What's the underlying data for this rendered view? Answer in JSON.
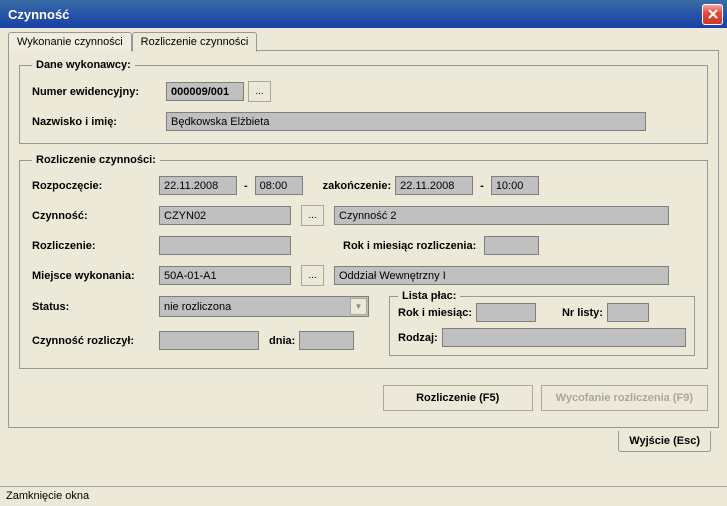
{
  "window": {
    "title": "Czynność"
  },
  "tabs": {
    "tab1": "Wykonanie czynności",
    "tab2": "Rozliczenie czynności"
  },
  "dane": {
    "legend": "Dane wykonawcy:",
    "numer_label": "Numer ewidencyjny:",
    "numer_value": "000009/001",
    "nazwisko_label": "Nazwisko i imię:",
    "nazwisko_value": "Będkowska Elżbieta"
  },
  "rozl": {
    "legend": "Rozliczenie czynności:",
    "rozp_label": "Rozpoczęcie:",
    "rozp_date": "22.11.2008",
    "rozp_time": "08:00",
    "zak_label": "zakończenie:",
    "zak_date": "22.11.2008",
    "zak_time": "10:00",
    "czynnosc_label": "Czynność:",
    "czynnosc_code": "CZYN02",
    "czynnosc_desc": "Czynność 2",
    "rozliczenie_label": "Rozliczenie:",
    "rozliczenie_value": "",
    "rok_mies_label": "Rok i miesiąc rozliczenia:",
    "rok_mies_value": "",
    "miejsce_label": "Miejsce wykonania:",
    "miejsce_code": "50A-01-A1",
    "miejsce_desc": "Oddział Wewnętrzny I",
    "status_label": "Status:",
    "status_value": "nie rozliczona",
    "czyn_rozl_label": "Czynność rozliczył:",
    "czyn_rozl_value": "",
    "dnia_label": "dnia:",
    "dnia_value": "",
    "lista": {
      "legend": "Lista płac:",
      "rok_label": "Rok i miesiąc:",
      "rok_value": "",
      "nr_label": "Nr listy:",
      "nr_value": "",
      "rodzaj_label": "Rodzaj:",
      "rodzaj_value": ""
    }
  },
  "buttons": {
    "rozliczenie": "Rozliczenie (F5)",
    "wycofanie": "Wycofanie rozliczenia (F9)",
    "wyjscie": "Wyjście (Esc)",
    "ellipsis": "..."
  },
  "statusbar": "Zamknięcie okna"
}
